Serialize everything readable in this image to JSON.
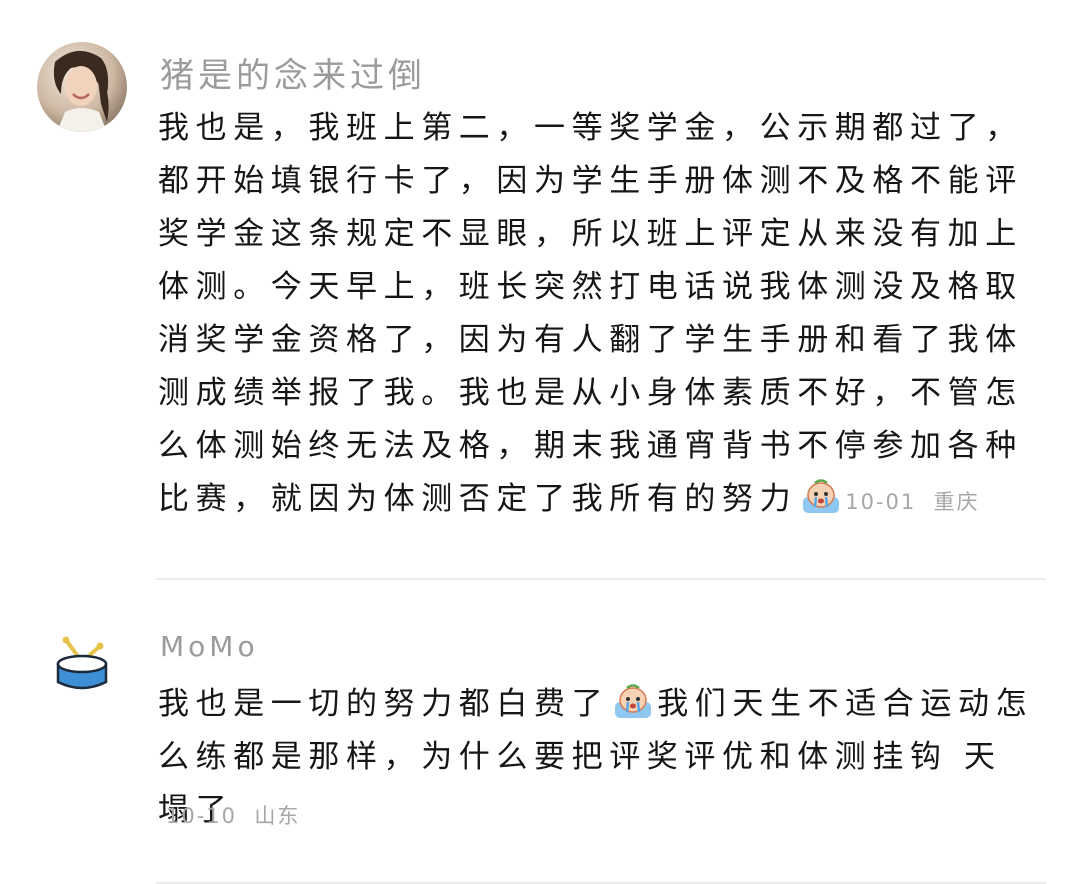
{
  "comments": [
    {
      "nickname": "猪是的念来过倒",
      "text": "我也是，我班上第二，一等奖学金，公示期都过了，都开始填银行卡了，因为学生手册体测不及格不能评奖学金这条规定不显眼，所以班上评定从来没有加上体测。今天早上，班长突然打电话说我体测没及格取消奖学金资格了，因为有人翻了学生手册和看了我体测成绩举报了我。我也是从小身体素质不好，不管怎么体测始终无法及格，期末我通宵背书不停参加各种比赛，就因为体测否定了我所有的努力",
      "emoji": "crying-emoji",
      "date": "10-01",
      "location": "重庆"
    },
    {
      "nickname": "MoMo",
      "text_before_emoji": "我也是一切的努力都白费了",
      "emoji": "crying-emoji",
      "text_after_emoji": "我们天生不适合运动怎么练都是那样，为什么要把评奖评优和体测挂钩 天塌了",
      "date": "10-10",
      "location": "山东"
    }
  ],
  "colors": {
    "nickname": "#9b9b9b",
    "text": "#161616",
    "meta": "#a7a7a7",
    "divider": "#ececec",
    "drum_body": "#3f8fd6",
    "drum_top": "#ffffff"
  }
}
